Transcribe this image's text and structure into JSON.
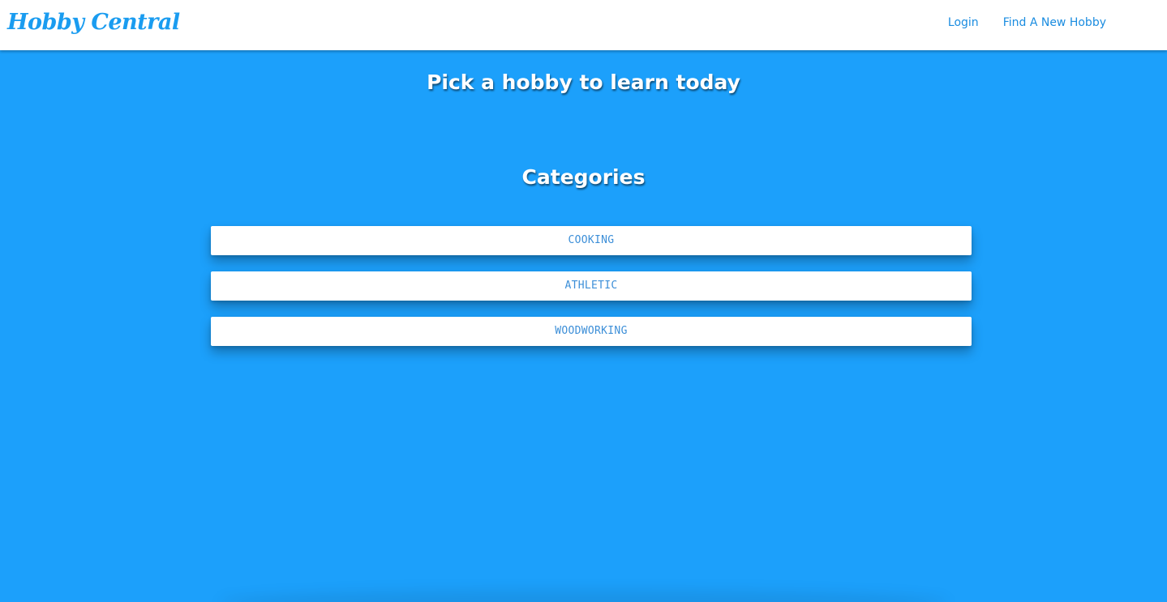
{
  "navbar": {
    "brand": "Hobby Central",
    "links": [
      {
        "label": "Login"
      },
      {
        "label": "Find A New Hobby"
      }
    ]
  },
  "main": {
    "headline": "Pick a hobby to learn today",
    "categories_title": "Categories",
    "categories": [
      {
        "label": "COOKING"
      },
      {
        "label": "ATHLETIC"
      },
      {
        "label": "WOODWORKING"
      }
    ]
  },
  "colors": {
    "background": "#1ca0fb",
    "brand": "#1a9cf0",
    "button_text": "#3d8fd8"
  }
}
